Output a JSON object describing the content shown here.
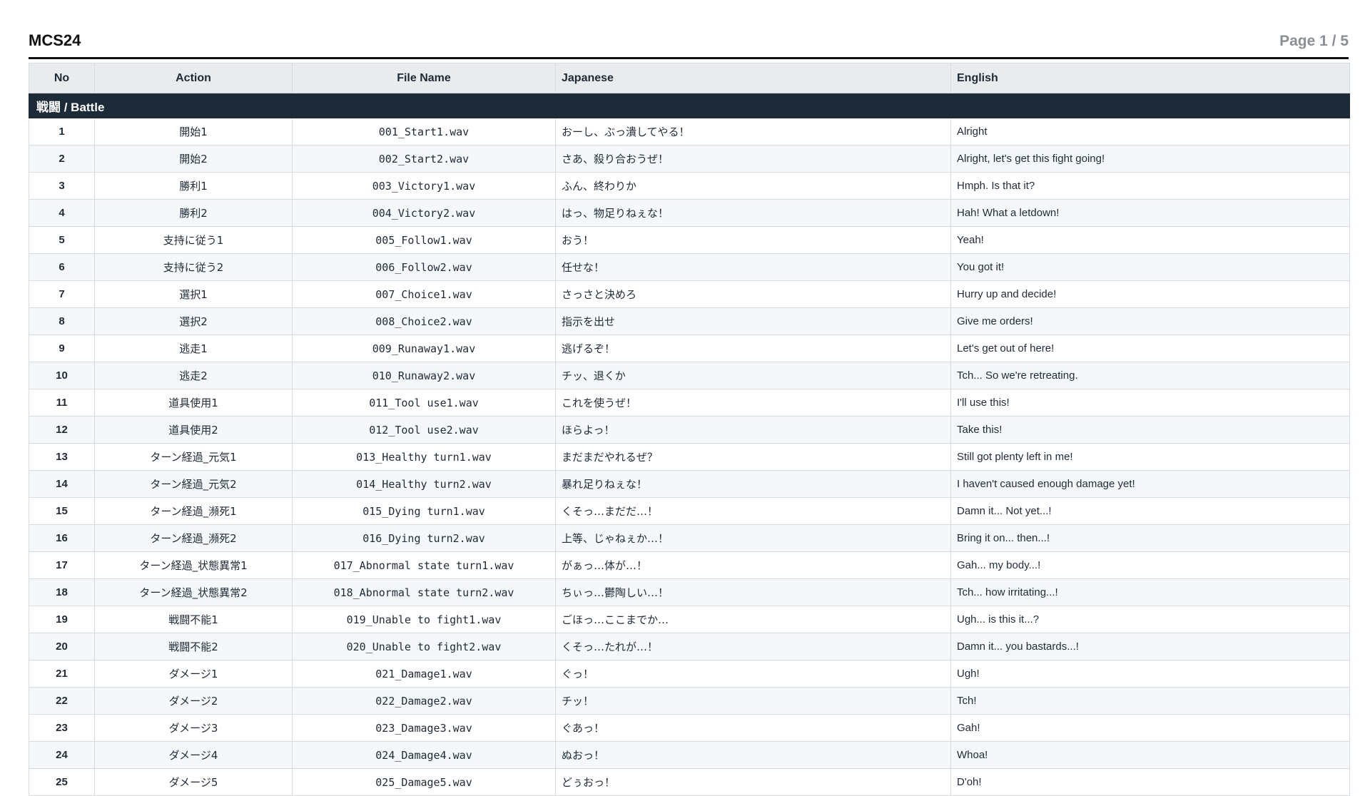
{
  "header": {
    "title": "MCS24",
    "page_indicator": "Page 1 / 5"
  },
  "table": {
    "columns": [
      "No",
      "Action",
      "File Name",
      "Japanese",
      "English"
    ],
    "section": "戦闘 / Battle",
    "rows": [
      {
        "no": "1",
        "action": "開始1",
        "file": "001_Start1.wav",
        "ja": "おーし、ぶっ潰してやる！",
        "en": "Alright"
      },
      {
        "no": "2",
        "action": "開始2",
        "file": "002_Start2.wav",
        "ja": "さあ、殺り合おうぜ！",
        "en": "Alright, let's get this fight going!"
      },
      {
        "no": "3",
        "action": "勝利1",
        "file": "003_Victory1.wav",
        "ja": "ふん、終わりか",
        "en": "Hmph. Is that it?"
      },
      {
        "no": "4",
        "action": "勝利2",
        "file": "004_Victory2.wav",
        "ja": "はっ、物足りねぇな！",
        "en": "Hah! What a letdown!"
      },
      {
        "no": "5",
        "action": "支持に従う1",
        "file": "005_Follow1.wav",
        "ja": "おう！",
        "en": "Yeah!"
      },
      {
        "no": "6",
        "action": "支持に従う2",
        "file": "006_Follow2.wav",
        "ja": "任せな！",
        "en": "You got it!"
      },
      {
        "no": "7",
        "action": "選択1",
        "file": "007_Choice1.wav",
        "ja": "さっさと決めろ",
        "en": "Hurry up and decide!"
      },
      {
        "no": "8",
        "action": "選択2",
        "file": "008_Choice2.wav",
        "ja": "指示を出せ",
        "en": "Give me orders!"
      },
      {
        "no": "9",
        "action": "逃走1",
        "file": "009_Runaway1.wav",
        "ja": "逃げるぞ！",
        "en": "Let's get out of here!"
      },
      {
        "no": "10",
        "action": "逃走2",
        "file": "010_Runaway2.wav",
        "ja": "チッ、退くか",
        "en": "Tch... So we're retreating."
      },
      {
        "no": "11",
        "action": "道具使用1",
        "file": "011_Tool use1.wav",
        "ja": "これを使うぜ！",
        "en": "I'll use this!"
      },
      {
        "no": "12",
        "action": "道具使用2",
        "file": "012_Tool use2.wav",
        "ja": "ほらよっ！",
        "en": "Take this!"
      },
      {
        "no": "13",
        "action": "ターン経過_元気1",
        "file": "013_Healthy turn1.wav",
        "ja": "まだまだやれるぜ？",
        "en": "Still got plenty left in me!"
      },
      {
        "no": "14",
        "action": "ターン経過_元気2",
        "file": "014_Healthy turn2.wav",
        "ja": "暴れ足りねぇな！",
        "en": "I haven't caused enough damage yet!"
      },
      {
        "no": "15",
        "action": "ターン経過_瀕死1",
        "file": "015_Dying turn1.wav",
        "ja": "くそっ…まだだ…！",
        "en": "Damn it... Not yet...!"
      },
      {
        "no": "16",
        "action": "ターン経過_瀕死2",
        "file": "016_Dying turn2.wav",
        "ja": "上等、じゃねぇか…！",
        "en": "Bring it on... then...!"
      },
      {
        "no": "17",
        "action": "ターン経過_状態異常1",
        "file": "017_Abnormal state turn1.wav",
        "ja": "がぁっ…体が…！",
        "en": "Gah... my body...!"
      },
      {
        "no": "18",
        "action": "ターン経過_状態異常2",
        "file": "018_Abnormal state turn2.wav",
        "ja": "ちぃっ…鬱陶しい…！",
        "en": "Tch... how irritating...!"
      },
      {
        "no": "19",
        "action": "戦闘不能1",
        "file": "019_Unable to fight1.wav",
        "ja": "ごほっ…ここまでか…",
        "en": "Ugh... is this it...?"
      },
      {
        "no": "20",
        "action": "戦闘不能2",
        "file": "020_Unable to fight2.wav",
        "ja": "くそっ…たれが…！",
        "en": "Damn it... you bastards...!"
      },
      {
        "no": "21",
        "action": "ダメージ1",
        "file": "021_Damage1.wav",
        "ja": "ぐっ！",
        "en": "Ugh!"
      },
      {
        "no": "22",
        "action": "ダメージ2",
        "file": "022_Damage2.wav",
        "ja": "チッ！",
        "en": "Tch!"
      },
      {
        "no": "23",
        "action": "ダメージ3",
        "file": "023_Damage3.wav",
        "ja": "ぐあっ！",
        "en": "Gah!"
      },
      {
        "no": "24",
        "action": "ダメージ4",
        "file": "024_Damage4.wav",
        "ja": "ぬおっ！",
        "en": "Whoa!"
      },
      {
        "no": "25",
        "action": "ダメージ5",
        "file": "025_Damage5.wav",
        "ja": "どぅおっ！",
        "en": "D'oh!"
      }
    ]
  }
}
